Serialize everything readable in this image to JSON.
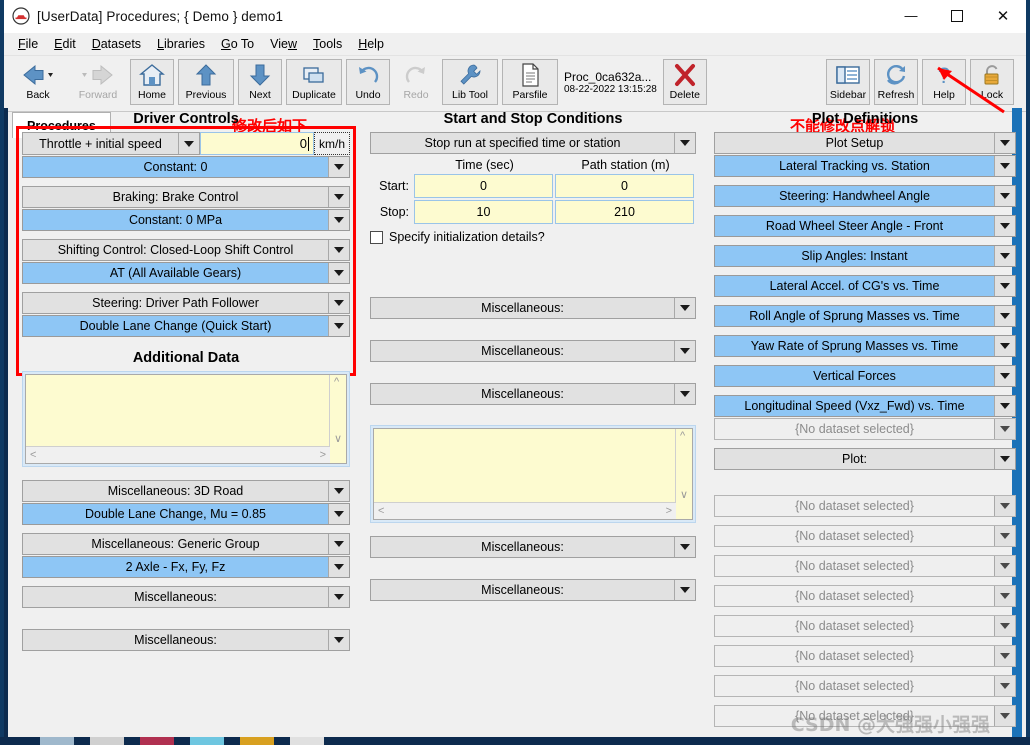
{
  "window": {
    "title": "[UserData] Procedures; { Demo } demo1",
    "app_icon": "car-icon",
    "controls": {
      "minimize": "minimize-icon",
      "maximize": "maximize-icon",
      "close": "close-icon"
    }
  },
  "menubar": {
    "items": [
      "File",
      "Edit",
      "Datasets",
      "Libraries",
      "Go To",
      "View",
      "Tools",
      "Help"
    ]
  },
  "toolbar": {
    "buttons": [
      {
        "label": "Back",
        "icon": "back-arrow-icon",
        "disabled": false,
        "split": true
      },
      {
        "label": "Forward",
        "icon": "forward-arrow-icon",
        "disabled": true,
        "split": true
      },
      {
        "label": "Home",
        "icon": "home-icon",
        "disabled": false
      },
      {
        "label": "Previous",
        "icon": "up-arrow-icon",
        "disabled": false
      },
      {
        "label": "Next",
        "icon": "down-arrow-icon",
        "disabled": false
      },
      {
        "label": "Duplicate",
        "icon": "duplicate-icon",
        "disabled": false
      },
      {
        "label": "Undo",
        "icon": "undo-icon",
        "disabled": false
      },
      {
        "label": "Redo",
        "icon": "redo-icon",
        "disabled": true
      },
      {
        "label": "Lib Tool",
        "icon": "wrench-icon",
        "disabled": false
      },
      {
        "label": "Parsfile",
        "icon": "document-icon",
        "disabled": false
      }
    ],
    "parsfile": {
      "name": "Proc_0ca632a...",
      "timestamp": "08-22-2022 13:15:28"
    },
    "delete": {
      "label": "Delete",
      "icon": "delete-x-icon"
    },
    "right_buttons": [
      {
        "label": "Sidebar",
        "icon": "sidebar-icon"
      },
      {
        "label": "Refresh",
        "icon": "refresh-icon"
      },
      {
        "label": "Help",
        "icon": "question-mark-icon"
      },
      {
        "label": "Lock",
        "icon": "padlock-icon"
      }
    ]
  },
  "tabs": [
    {
      "label": "Procedures",
      "active": true
    }
  ],
  "annotations": {
    "left": "修改后如下",
    "right": "不能修改点解锁"
  },
  "driver_controls": {
    "heading": "Driver Controls",
    "speed_row": {
      "mode": "Throttle + initial speed",
      "value": "0",
      "unit": "km/h"
    },
    "rows": [
      {
        "title": "Constant: 0",
        "selected": true
      },
      {
        "title": "Braking: Brake Control",
        "selected": false
      },
      {
        "title": "Constant: 0 MPa",
        "selected": true
      },
      {
        "title": "Shifting Control: Closed-Loop Shift Control",
        "selected": false
      },
      {
        "title": "AT (All Available Gears)",
        "selected": true
      },
      {
        "title": "Steering: Driver Path Follower",
        "selected": false
      },
      {
        "title": "Double Lane Change (Quick Start)",
        "selected": true
      }
    ]
  },
  "additional_data": {
    "heading": "Additional Data",
    "textarea_value": "",
    "combos": [
      {
        "title": "Miscellaneous: 3D Road",
        "selected": false
      },
      {
        "title": "Double Lane Change, Mu = 0.85",
        "selected": true
      },
      {
        "title": "Miscellaneous: Generic Group",
        "selected": false
      },
      {
        "title": "2 Axle - Fx, Fy, Fz",
        "selected": true
      },
      {
        "title": "Miscellaneous:",
        "selected": false
      },
      {
        "title": "Miscellaneous:",
        "selected": false
      }
    ]
  },
  "start_stop": {
    "heading": "Start and Stop Conditions",
    "mode": "Stop run at specified time or station",
    "columns": [
      "Time (sec)",
      "Path station (m)"
    ],
    "rows": [
      {
        "label": "Start:",
        "time": "0",
        "station": "0"
      },
      {
        "label": "Stop:",
        "time": "10",
        "station": "210"
      }
    ],
    "checkbox": {
      "label": "Specify initialization details?",
      "checked": false
    },
    "misc_top": [
      {
        "title": "Miscellaneous:"
      },
      {
        "title": "Miscellaneous:"
      },
      {
        "title": "Miscellaneous:"
      }
    ],
    "textarea_value": "",
    "misc_bottom": [
      {
        "title": "Miscellaneous:"
      },
      {
        "title": "Miscellaneous:"
      }
    ]
  },
  "plot_definitions": {
    "heading": "Plot Definitions",
    "setup": {
      "title": "Plot Setup",
      "selected": false
    },
    "plots": [
      {
        "title": "Lateral Tracking vs. Station",
        "selected": true
      },
      {
        "title": "Steering: Handwheel Angle",
        "selected": true
      },
      {
        "title": "Road Wheel Steer Angle - Front",
        "selected": true
      },
      {
        "title": "Slip Angles: Instant",
        "selected": true
      },
      {
        "title": "Lateral Accel. of CG's vs. Time",
        "selected": true
      },
      {
        "title": "Roll Angle of Sprung Masses vs. Time",
        "selected": true
      },
      {
        "title": "Yaw Rate of Sprung Masses vs. Time",
        "selected": true
      },
      {
        "title": "Vertical Forces",
        "selected": true
      },
      {
        "title": "Longitudinal Speed (Vxz_Fwd) vs. Time",
        "selected": true
      },
      {
        "title": "{No dataset selected}",
        "selected": false,
        "empty": true
      }
    ],
    "plot_combo": {
      "title": "Plot:",
      "selected": false
    },
    "empty_rows": [
      {
        "title": "{No dataset selected}",
        "empty": true
      },
      {
        "title": "{No dataset selected}",
        "empty": true
      },
      {
        "title": "{No dataset selected}",
        "empty": true
      },
      {
        "title": "{No dataset selected}",
        "empty": true
      },
      {
        "title": "{No dataset selected}",
        "empty": true
      },
      {
        "title": "{No dataset selected}",
        "empty": true
      },
      {
        "title": "{No dataset selected}",
        "empty": true
      },
      {
        "title": "{No dataset selected}",
        "empty": true
      }
    ]
  },
  "watermark": "CSDN @大强强小强强",
  "colors": {
    "selected_blue": "#8ec6f5",
    "field_yellow": "#fdfbd0",
    "annotation_red": "#ff0000",
    "window_border": "#103a63"
  }
}
